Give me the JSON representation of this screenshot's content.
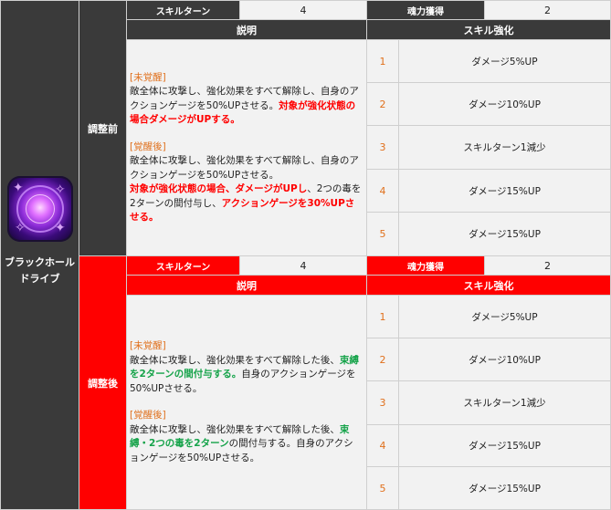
{
  "skill": {
    "name_line1": "ブラックホール",
    "name_line2": "ドライブ",
    "icon": "black-hole-skill-icon"
  },
  "before": {
    "label": "調整前",
    "skill_turn_label": "スキルターン",
    "skill_turn_value": "4",
    "soul_label": "魂力獲得",
    "soul_value": "2",
    "desc_header": "説明",
    "enh_header": "スキル強化",
    "unawakened_tag": "[未覚醒]",
    "unawakened_text": "敵全体に攻撃し、強化効果をすべて解除し、自身のアクションゲージを50%UPさせる。",
    "unawakened_highlight": "対象が強化状態の場合ダメージがUPする。",
    "awakened_tag": "[覚醒後]",
    "awakened_text": "敵全体に攻撃し、強化効果をすべて解除し、自身のアクションゲージを50%UPさせる。",
    "awakened_highlight_1": "対象が強化状態の場合、ダメージがUPし",
    "awakened_text_2": "、2つの毒を2ターンの間付与し、",
    "awakened_highlight_2": "アクションゲージを30%UPさせる。",
    "enhancements": [
      {
        "level": "1",
        "effect": "ダメージ5%UP"
      },
      {
        "level": "2",
        "effect": "ダメージ10%UP"
      },
      {
        "level": "3",
        "effect": "スキルターン1減少"
      },
      {
        "level": "4",
        "effect": "ダメージ15%UP"
      },
      {
        "level": "5",
        "effect": "ダメージ15%UP"
      }
    ]
  },
  "after": {
    "label": "調整後",
    "skill_turn_label": "スキルターン",
    "skill_turn_value": "4",
    "soul_label": "魂力獲得",
    "soul_value": "2",
    "desc_header": "説明",
    "enh_header": "スキル強化",
    "unawakened_tag": "[未覚醒]",
    "unawakened_text": "敵全体に攻撃し、強化効果をすべて解除した後、",
    "unawakened_highlight": "束縛を2ターンの間付与する。",
    "unawakened_text_2": "自身のアクションゲージを50%UPさせる。",
    "awakened_tag": "[覚醒後]",
    "awakened_text": "敵全体に攻撃し、強化効果をすべて解除した後、",
    "awakened_highlight": "束縛・2つの毒を2ターン",
    "awakened_text_2": "の間付与する。自身のアクションゲージを50%UPさせる。",
    "enhancements": [
      {
        "level": "1",
        "effect": "ダメージ5%UP"
      },
      {
        "level": "2",
        "effect": "ダメージ10%UP"
      },
      {
        "level": "3",
        "effect": "スキルターン1減少"
      },
      {
        "level": "4",
        "effect": "ダメージ15%UP"
      },
      {
        "level": "5",
        "effect": "ダメージ15%UP"
      }
    ]
  },
  "colors": {
    "dark": "#3a3a3a",
    "red": "#ff0000",
    "orange": "#e0701c",
    "green": "#16a34a",
    "cell": "#f2f2f2"
  }
}
